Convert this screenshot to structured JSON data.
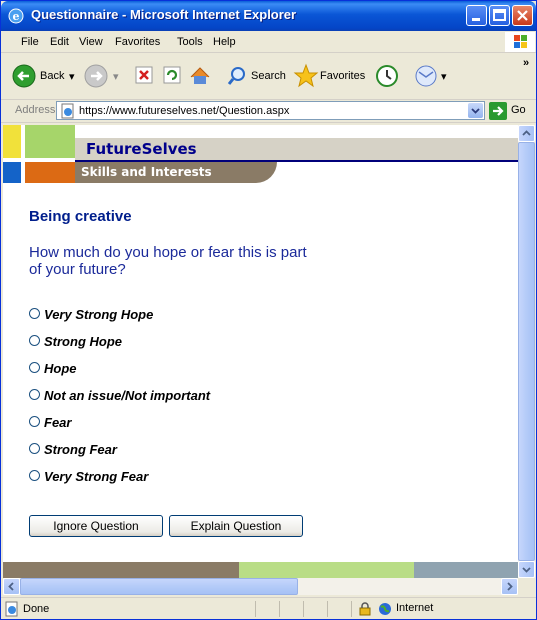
{
  "window": {
    "title": "Questionnaire - Microsoft Internet Explorer"
  },
  "menu": {
    "items": [
      "File",
      "Edit",
      "View",
      "Favorites",
      "Tools",
      "Help"
    ]
  },
  "toolbar": {
    "back_label": "Back",
    "search_label": "Search",
    "favorites_label": "Favorites",
    "chevron": "»"
  },
  "address": {
    "label": "Address",
    "url": "https://www.futureselves.net/Question.aspx",
    "go_label": "Go"
  },
  "page": {
    "brand": "FutureSelves",
    "subtitle": "Skills and Interests",
    "section_title": "Being creative",
    "question": "How much do you hope or fear this is part of your future?",
    "options": [
      "Very Strong Hope",
      "Strong Hope",
      "Hope",
      "Not an issue/Not important",
      "Fear",
      "Strong Fear",
      "Very Strong Fear"
    ],
    "ignore_button": "Ignore Question",
    "explain_button": "Explain Question"
  },
  "status": {
    "text": "Done",
    "zone": "Internet"
  },
  "colors": {
    "title_bar": "#0a56d6",
    "brand_text": "#00008b",
    "question_text": "#1b2a9a"
  }
}
